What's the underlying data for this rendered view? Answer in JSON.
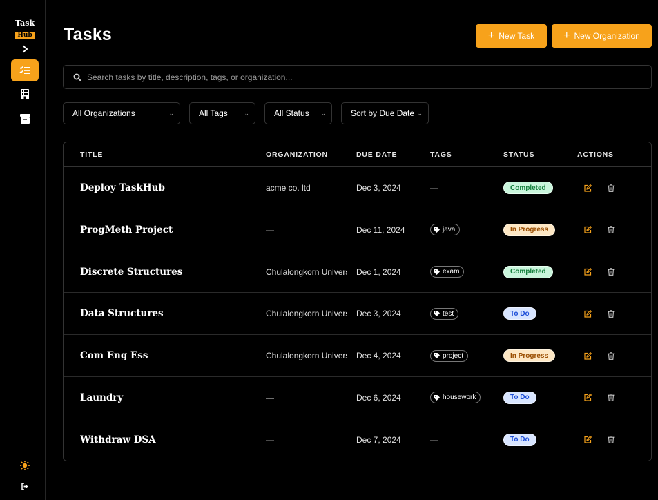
{
  "app": {
    "logo_top": "Task",
    "logo_bottom": "Hub"
  },
  "sidebar": {
    "items": [
      {
        "name": "tasks",
        "icon": "task-list-icon",
        "active": true
      },
      {
        "name": "organizations",
        "icon": "building-icon",
        "active": false
      },
      {
        "name": "archive",
        "icon": "archive-icon",
        "active": false
      }
    ],
    "bottom": [
      {
        "name": "theme",
        "icon": "sun-icon"
      },
      {
        "name": "logout",
        "icon": "logout-icon"
      }
    ]
  },
  "header": {
    "title": "Tasks",
    "new_task_label": "New Task",
    "new_org_label": "New Organization"
  },
  "search": {
    "placeholder": "Search tasks by title, description, tags, or organization..."
  },
  "filters": {
    "organization": "All Organizations",
    "tags": "All Tags",
    "status": "All Status",
    "sort": "Sort by Due Date"
  },
  "table": {
    "headers": {
      "title": "TITLE",
      "organization": "ORGANIZATION",
      "due_date": "DUE DATE",
      "tags": "TAGS",
      "status": "STATUS",
      "actions": "ACTIONS"
    },
    "rows": [
      {
        "title": "Deploy TaskHub",
        "organization": "acme co. ltd",
        "due": "Dec 3, 2024",
        "tag": "",
        "no_tag": "—",
        "status": "Completed",
        "status_kind": "completed"
      },
      {
        "title": "ProgMeth Project",
        "organization": "—",
        "due": "Dec 11, 2024",
        "tag": "java",
        "no_tag": "",
        "status": "In Progress",
        "status_kind": "progress"
      },
      {
        "title": "Discrete Structures",
        "organization": "Chulalongkorn Univers",
        "due": "Dec 1, 2024",
        "tag": "exam",
        "no_tag": "",
        "status": "Completed",
        "status_kind": "completed"
      },
      {
        "title": "Data Structures",
        "organization": "Chulalongkorn Univers",
        "due": "Dec 3, 2024",
        "tag": "test",
        "no_tag": "",
        "status": "To Do",
        "status_kind": "todo"
      },
      {
        "title": "Com Eng Ess",
        "organization": "Chulalongkorn Univers",
        "due": "Dec 4, 2024",
        "tag": "project",
        "no_tag": "",
        "status": "In Progress",
        "status_kind": "progress"
      },
      {
        "title": "Laundry",
        "organization": "—",
        "due": "Dec 6, 2024",
        "tag": "housework",
        "no_tag": "",
        "status": "To Do",
        "status_kind": "todo"
      },
      {
        "title": "Withdraw DSA",
        "organization": "—",
        "due": "Dec 7, 2024",
        "tag": "",
        "no_tag": "—",
        "status": "To Do",
        "status_kind": "todo"
      }
    ]
  },
  "colors": {
    "accent": "#f7a21b",
    "background": "#000000",
    "border": "#333333"
  }
}
